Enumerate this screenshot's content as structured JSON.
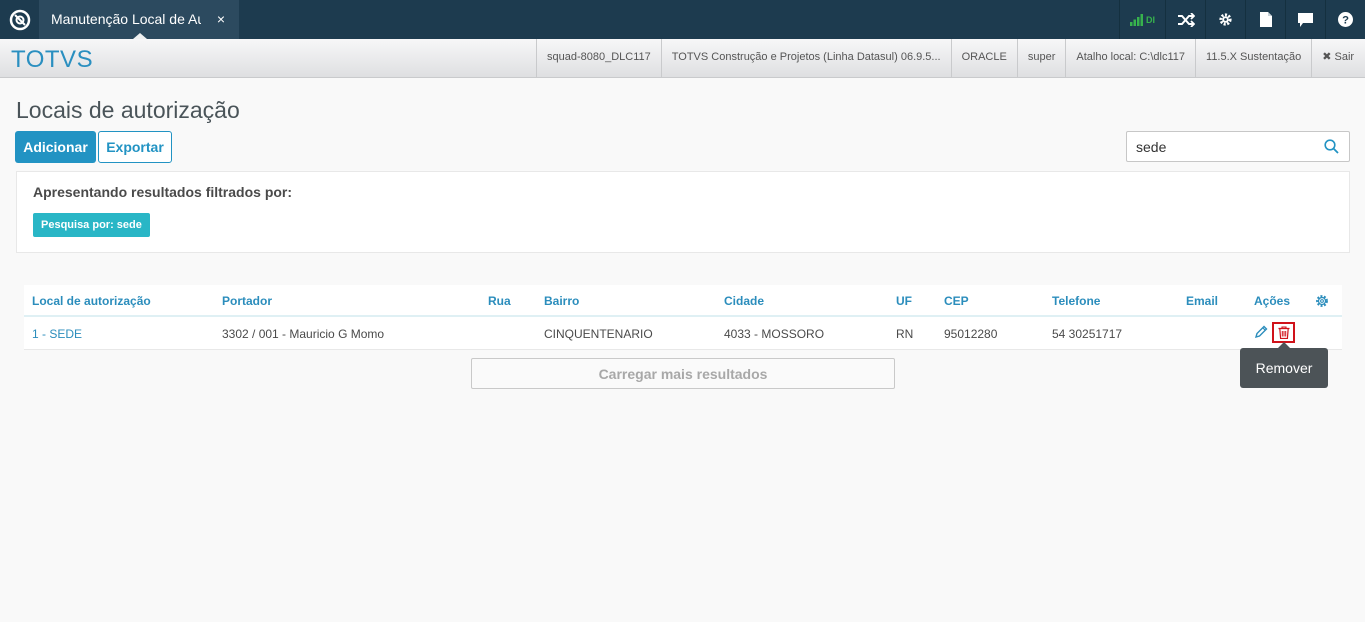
{
  "topbar": {
    "tab_label": "Manutenção Local de Autorização",
    "tab_close": "×",
    "signal_text": "DI"
  },
  "header": {
    "brand": "TOTVS",
    "info": [
      "squad-8080_DLC117",
      "TOTVS Construção e Projetos (Linha Datasul) 06.9.5...",
      "ORACLE",
      "super",
      "Atalho local: C:\\dlc117",
      "11.5.X Sustentação"
    ],
    "exit_label": "✖ Sair"
  },
  "page": {
    "title": "Locais de autorização",
    "add_label": "Adicionar",
    "export_label": "Exportar",
    "search_value": "sede",
    "filter_title": "Apresentando resultados filtrados por:",
    "filter_chip": "Pesquisa por: sede"
  },
  "table": {
    "headers": [
      "Local de autorização",
      "Portador",
      "Rua",
      "Bairro",
      "Cidade",
      "UF",
      "CEP",
      "Telefone",
      "Email",
      "Ações"
    ],
    "rows": [
      {
        "local": "1 - SEDE",
        "portador": "3302 / 001 - Mauricio G Momo",
        "rua": "",
        "bairro": "CINQUENTENARIO",
        "cidade": "4033 - MOSSORO",
        "uf": "RN",
        "cep": "95012280",
        "telefone": "54 30251717",
        "email": ""
      }
    ],
    "load_more": "Carregar mais resultados",
    "tooltip": "Remover"
  },
  "colors": {
    "topbar": "#1d3b4f",
    "brand": "#2a8fc0",
    "primary": "#2293c3",
    "chip": "#29b6c6",
    "delete_highlight": "#d0121a"
  }
}
